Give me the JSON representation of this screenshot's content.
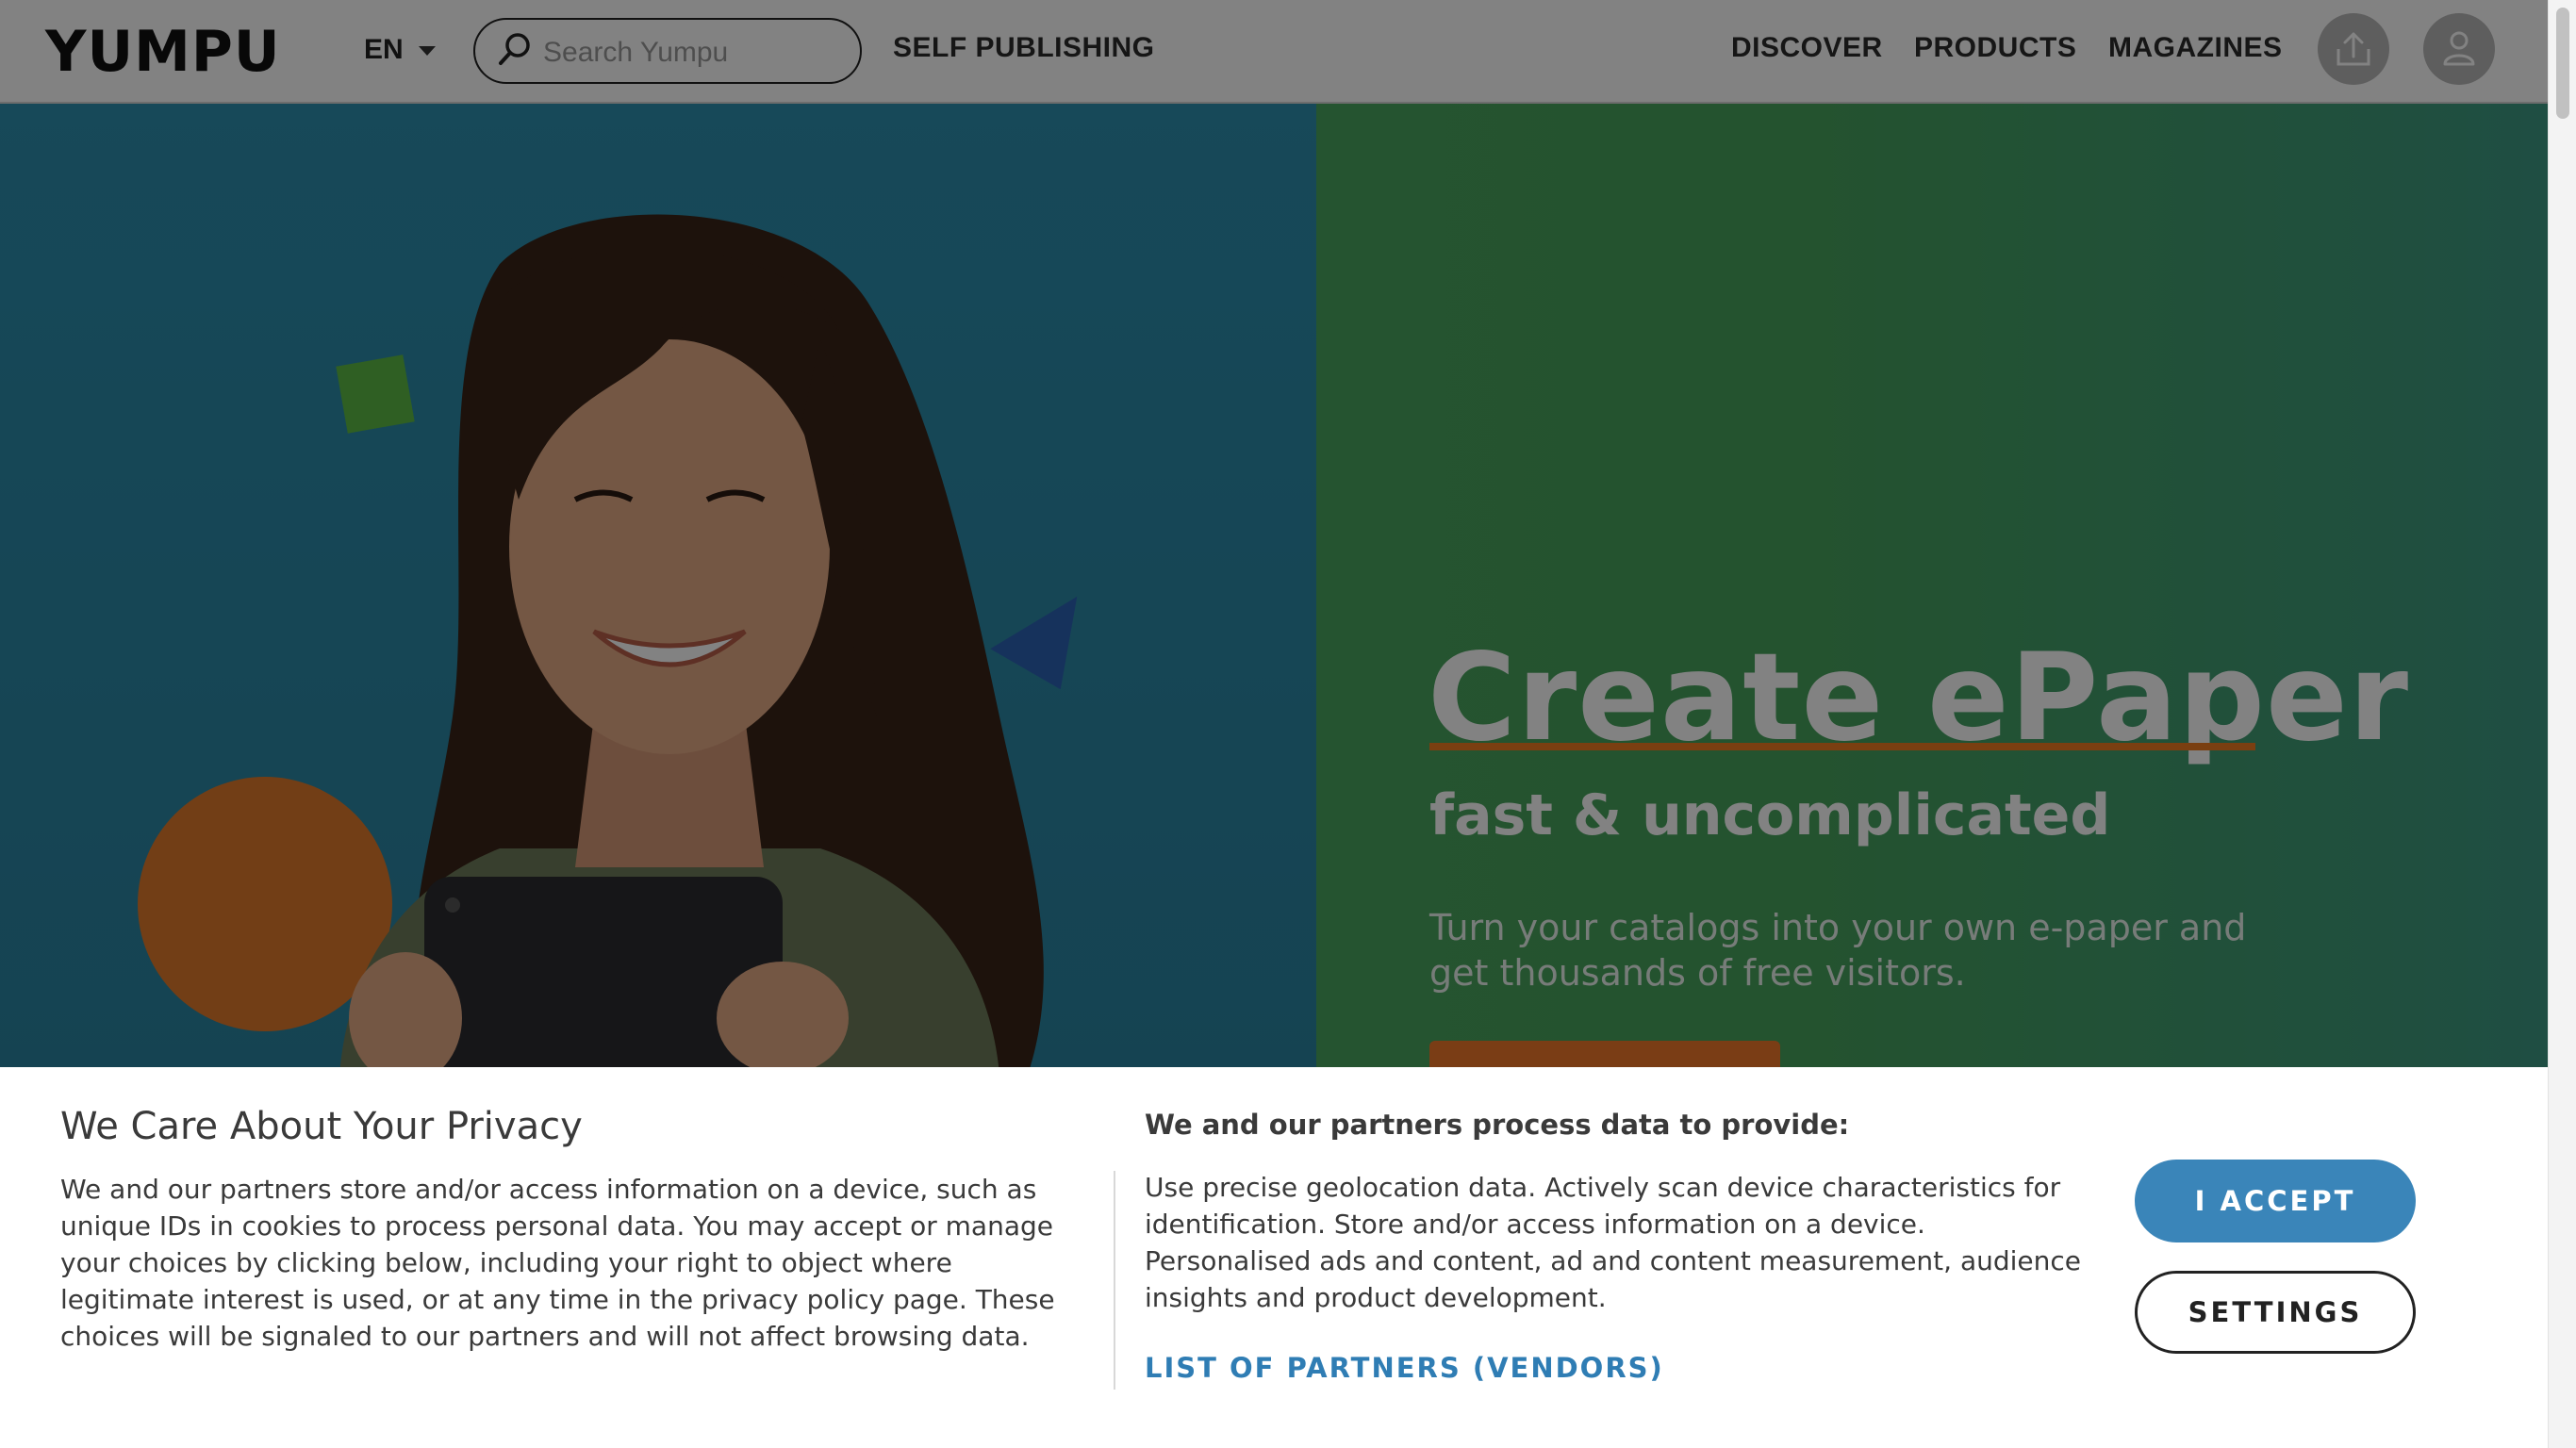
{
  "header": {
    "logo": "YUMPU",
    "language": "EN",
    "search_placeholder": "Search Yumpu",
    "self_publishing": "SELF PUBLISHING",
    "nav": [
      "DISCOVER",
      "PRODUCTS",
      "MAGAZINES"
    ]
  },
  "hero": {
    "title": "Create ePaper",
    "subtitle": "fast & uncomplicated",
    "text": "Turn your catalogs into your own e-paper and get thousands of free visitors."
  },
  "cookie_banner": {
    "title": "We Care About Your Privacy",
    "text": "We and our partners store and/or access information on a device, such as unique IDs in cookies to process personal data. You may accept or manage your choices by clicking below, including your right to object where legitimate interest is used, or at any time in the privacy policy page. These choices will be signaled to our partners and will not affect browsing data.",
    "purposes_title": "We and our partners process data to provide:",
    "purposes_text": "Use precise geolocation data. Actively scan device characteristics for identification. Store and/or access information on a device. Personalised ads and content, ad and content measurement, audience insights and product development.",
    "partners_link": "LIST OF PARTNERS (VENDORS)",
    "accept_label": "I ACCEPT",
    "settings_label": "SETTINGS"
  },
  "colors": {
    "accent_blue": "#3a85b9",
    "link_blue": "#2f7db4",
    "hero_orange": "#f0782a",
    "hero_green": "#4aa55e",
    "hero_teal": "#2d8fae"
  },
  "icons": [
    "search-icon",
    "chevron-down-icon",
    "upload-icon",
    "user-icon"
  ]
}
